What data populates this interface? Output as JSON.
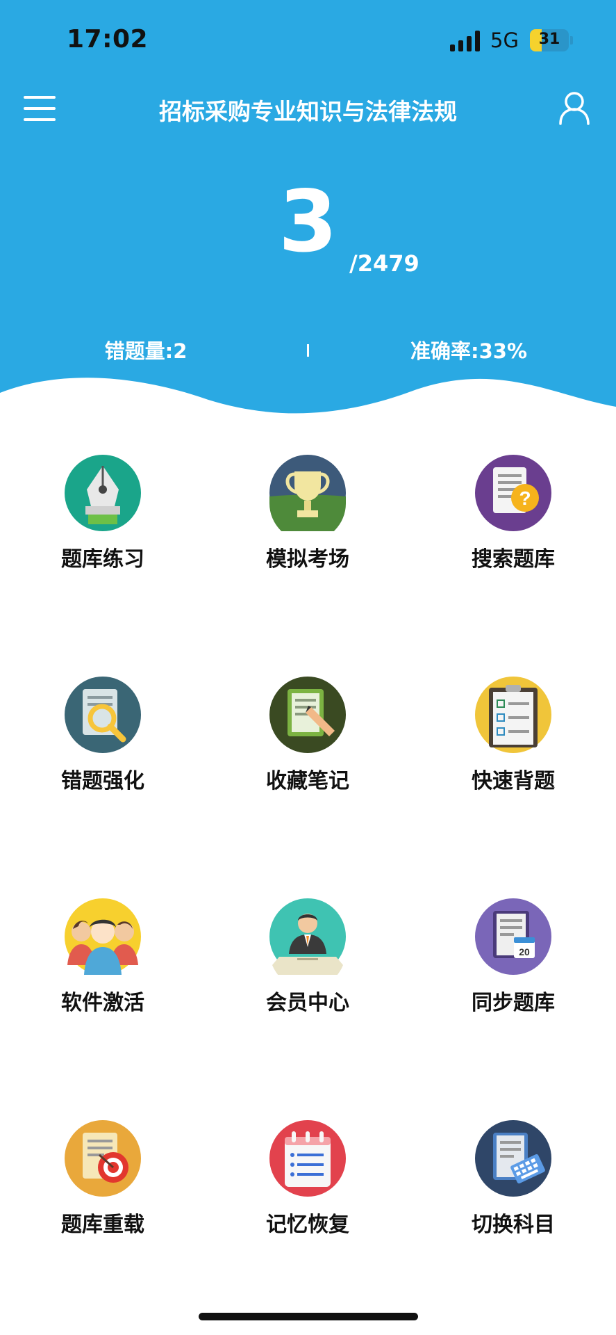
{
  "status_bar": {
    "time": "17:02",
    "network": "5G",
    "battery": "31",
    "battery_level": 0.31
  },
  "nav": {
    "title": "招标采购专业知识与法律法规",
    "menu_icon": "menu-icon",
    "user_icon": "user-icon"
  },
  "progress": {
    "done": "3",
    "total": "/2479"
  },
  "stats": {
    "wrong": "错题量:2",
    "accuracy": "准确率:33%"
  },
  "colors": {
    "header_bg": "#2AA9E3",
    "text_dark": "#111111"
  },
  "menu": [
    {
      "label": "题库练习",
      "icon": "pen-nib-icon"
    },
    {
      "label": "模拟考场",
      "icon": "trophy-icon"
    },
    {
      "label": "搜索题库",
      "icon": "document-question-icon"
    },
    {
      "label": "错题强化",
      "icon": "document-magnifier-icon"
    },
    {
      "label": "收藏笔记",
      "icon": "document-pencil-icon"
    },
    {
      "label": "快速背题",
      "icon": "clipboard-checklist-icon"
    },
    {
      "label": "软件激活",
      "icon": "people-group-icon"
    },
    {
      "label": "会员中心",
      "icon": "businessman-icon"
    },
    {
      "label": "同步题库",
      "icon": "document-calendar-icon"
    },
    {
      "label": "题库重载",
      "icon": "document-target-icon"
    },
    {
      "label": "记忆恢复",
      "icon": "notepad-list-icon"
    },
    {
      "label": "切换科目",
      "icon": "document-keyboard-icon"
    }
  ]
}
